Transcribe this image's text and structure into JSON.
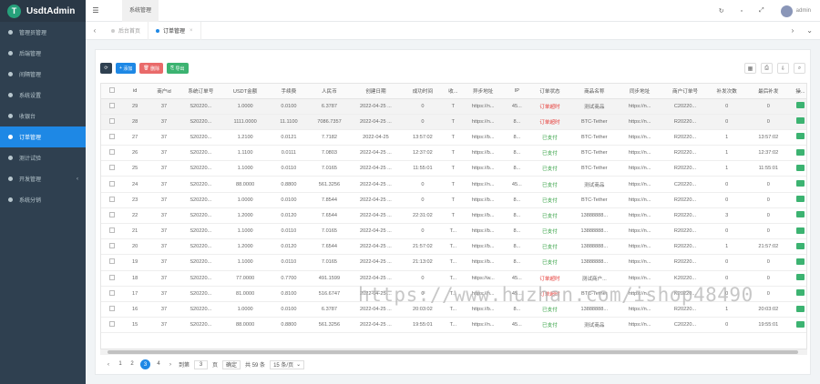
{
  "app": {
    "title": "UsdtAdmin",
    "logo_letter": "T"
  },
  "sidebar": {
    "items": [
      {
        "label": "管理员管理"
      },
      {
        "label": "后端管理"
      },
      {
        "label": "间隔管理"
      },
      {
        "label": "系统设置"
      },
      {
        "label": "收银台"
      },
      {
        "label": "订单管理",
        "active": true
      },
      {
        "label": "测计试验"
      },
      {
        "label": "开发管理",
        "has_children": true
      },
      {
        "label": "系统分销"
      }
    ]
  },
  "header": {
    "label": "系统管理",
    "user": "admin"
  },
  "tabs": [
    {
      "label": "后台首页"
    },
    {
      "label": "订单管理",
      "active": true
    }
  ],
  "toolbar": {
    "add": "添加",
    "delete": "删除",
    "export": "导出"
  },
  "table": {
    "headers": [
      "id",
      "商户id",
      "系统订单号",
      "USDT金额",
      "手续费",
      "人民币",
      "创建日期",
      "成功时间",
      "收...",
      "异步地址",
      "IP",
      "订单状态",
      "商品名称",
      "同步地址",
      "商户订单号",
      "补发次数",
      "最后补发",
      "操..."
    ],
    "rows": [
      [
        "29",
        "37",
        "S20220...",
        "1.0000",
        "0.0100",
        "6.3787",
        "2022-04-25 ...",
        "0",
        "T",
        "https://n...",
        "45...",
        "订单超时",
        "测试商品",
        "https://n...",
        "C20220...",
        "0",
        "0"
      ],
      [
        "28",
        "37",
        "S20220...",
        "1111.0000",
        "11.1100",
        "7086.7357",
        "2022-04-25 ...",
        "0",
        "T",
        "https://n...",
        "8...",
        "订单超时",
        "BTC-Tether",
        "https://n...",
        "R20220...",
        "0",
        "0"
      ],
      [
        "27",
        "37",
        "S20220...",
        "1.2100",
        "0.0121",
        "7.7182",
        "2022-04-25",
        "13:57:02",
        "T",
        "https://b...",
        "8...",
        "已支付",
        "BTC-Tether",
        "https://n...",
        "R20220...",
        "1",
        "13:57:02"
      ],
      [
        "26",
        "37",
        "S20220...",
        "1.1100",
        "0.0111",
        "7.0803",
        "2022-04-25 ...",
        "12:37:02",
        "T",
        "https://b...",
        "8...",
        "已支付",
        "BTC-Tether",
        "https://n...",
        "R20220...",
        "1",
        "12:37:02"
      ],
      [
        "25",
        "37",
        "S20220...",
        "1.1000",
        "0.0110",
        "7.0165",
        "2022-04-25 ...",
        "11:55:01",
        "T",
        "https://b...",
        "8...",
        "已支付",
        "BTC-Tether",
        "https://n...",
        "R20220...",
        "1",
        "11:55:01"
      ],
      [
        "24",
        "37",
        "S20220...",
        "88.0000",
        "0.8800",
        "561.3256",
        "2022-04-25 ...",
        "0",
        "T",
        "https://n...",
        "45...",
        "已支付",
        "测试商品",
        "https://n...",
        "C20220...",
        "0",
        "0"
      ],
      [
        "23",
        "37",
        "S20220...",
        "1.0000",
        "0.0100",
        "7.8544",
        "2022-04-25 ...",
        "0",
        "T",
        "https://b...",
        "8...",
        "已支付",
        "BTC-Tether",
        "https://n...",
        "R20220...",
        "0",
        "0"
      ],
      [
        "22",
        "37",
        "S20220...",
        "1.2000",
        "0.0120",
        "7.6544",
        "2022-04-25 ...",
        "22:31:02",
        "T",
        "https://b...",
        "8...",
        "已支付",
        "13888888...",
        "https://n...",
        "R20220...",
        "3",
        "0"
      ],
      [
        "21",
        "37",
        "S20220...",
        "1.1000",
        "0.0110",
        "7.0165",
        "2022-04-25 ...",
        "0",
        "T...",
        "https://b...",
        "8...",
        "已支付",
        "13888888...",
        "https://n...",
        "R20220...",
        "0",
        "0"
      ],
      [
        "20",
        "37",
        "S20220...",
        "1.2000",
        "0.0120",
        "7.6544",
        "2022-04-25 ...",
        "21:57:02",
        "T...",
        "https://b...",
        "8...",
        "已支付",
        "13888888...",
        "https://n...",
        "R20220...",
        "1",
        "21:57:02"
      ],
      [
        "19",
        "37",
        "S20220...",
        "1.1000",
        "0.0110",
        "7.0165",
        "2022-04-25 ...",
        "21:13:02",
        "T...",
        "https://b...",
        "8...",
        "已支付",
        "13888888...",
        "https://n...",
        "R20220...",
        "0",
        "0"
      ],
      [
        "18",
        "37",
        "S20220...",
        "77.0000",
        "0.7700",
        "491.1599",
        "2022-04-25 ...",
        "0",
        "T...",
        "https://w...",
        "45...",
        "订单超时",
        "测试商户...",
        "https://n...",
        "K20220...",
        "0",
        "0"
      ],
      [
        "17",
        "37",
        "S20220...",
        "81.0000",
        "0.8100",
        "516.6747",
        "2022-04-25 ...",
        "0",
        "T...",
        "https://n...",
        "45...",
        "订单超时",
        "BTC-Tether",
        "https://n...",
        "K20220...",
        "0",
        "0"
      ],
      [
        "16",
        "37",
        "S20220...",
        "1.0000",
        "0.0100",
        "6.3787",
        "2022-04-25 ...",
        "20:03:02",
        "T...",
        "https://b...",
        "8...",
        "已支付",
        "13888888...",
        "https://n...",
        "R20220...",
        "1",
        "20:03:02"
      ],
      [
        "15",
        "37",
        "S20220...",
        "88.0000",
        "0.8800",
        "561.3256",
        "2022-04-25 ...",
        "19:55:01",
        "T...",
        "https://n...",
        "45...",
        "已支付",
        "测试商品",
        "https://n...",
        "C20220...",
        "0",
        "19:55:01"
      ]
    ]
  },
  "pagination": {
    "pages": [
      "1",
      "2",
      "3",
      "4"
    ],
    "active_page": "3",
    "goto_label": "到第",
    "goto_value": "3",
    "page_unit": "页",
    "confirm": "确定",
    "total": "共 59 条",
    "page_size": "15 条/页"
  },
  "watermark": "https://www.huzhan.com/ishop48490",
  "colors": {
    "primary": "#1e88e5",
    "sidebar": "#2f4050",
    "success": "#2e9e3e",
    "danger": "#e53935"
  }
}
